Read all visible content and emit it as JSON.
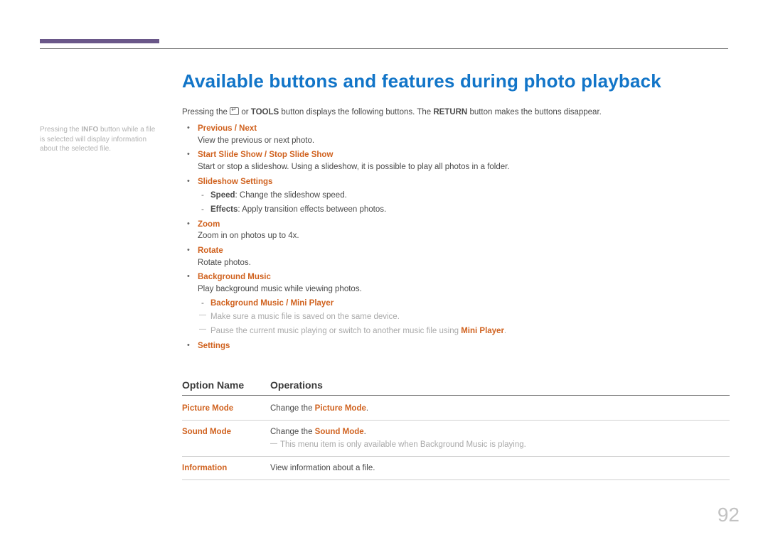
{
  "title": "Available buttons and features during photo playback",
  "intro": {
    "p1": "Pressing the ",
    "p2": " or ",
    "tools": "TOOLS",
    "p3": " button displays the following buttons. The ",
    "return": "RETURN",
    "p4": " button makes the buttons disappear."
  },
  "sidenote": {
    "p1": "Pressing the ",
    "info": "INFO",
    "p2": " button while a file is selected will display information about the selected file."
  },
  "items": [
    {
      "head": "Previous / Next",
      "desc": "View the previous or next photo."
    },
    {
      "head": "Start Slide Show / Stop Slide Show",
      "desc": "Start or stop a slideshow. Using a slideshow, it is possible to play all photos in a folder."
    },
    {
      "head": "Slideshow Settings",
      "subs": [
        {
          "em": "Speed",
          "text": ": Change the slideshow speed."
        },
        {
          "em": "Effects",
          "text": ": Apply transition effects between photos."
        }
      ]
    },
    {
      "head": "Zoom",
      "desc": "Zoom in on photos up to 4x."
    },
    {
      "head": "Rotate",
      "desc": "Rotate photos."
    },
    {
      "head": "Background Music",
      "desc": "Play background music while viewing photos.",
      "subs2": [
        {
          "hl": "Background Music / Mini Player"
        }
      ],
      "notes": [
        "Make sure a music file is saved on the same device.",
        {
          "pre": "Pause the current music playing or switch to another music file using ",
          "hl": "Mini Player",
          "post": "."
        }
      ]
    },
    {
      "head": "Settings"
    }
  ],
  "table": {
    "h1": "Option Name",
    "h2": "Operations",
    "rows": [
      {
        "name": "Picture Mode",
        "op_pre": "Change the ",
        "op_hl": "Picture Mode",
        "op_post": "."
      },
      {
        "name": "Sound Mode",
        "op_pre": "Change the ",
        "op_hl": "Sound Mode",
        "op_post": ".",
        "note_pre": "This menu item is only available when ",
        "note_hl": "Background Music",
        "note_post": " is playing."
      },
      {
        "name": "Information",
        "op_pre": "View information about a file.",
        "op_hl": "",
        "op_post": ""
      }
    ]
  },
  "page_number": "92"
}
